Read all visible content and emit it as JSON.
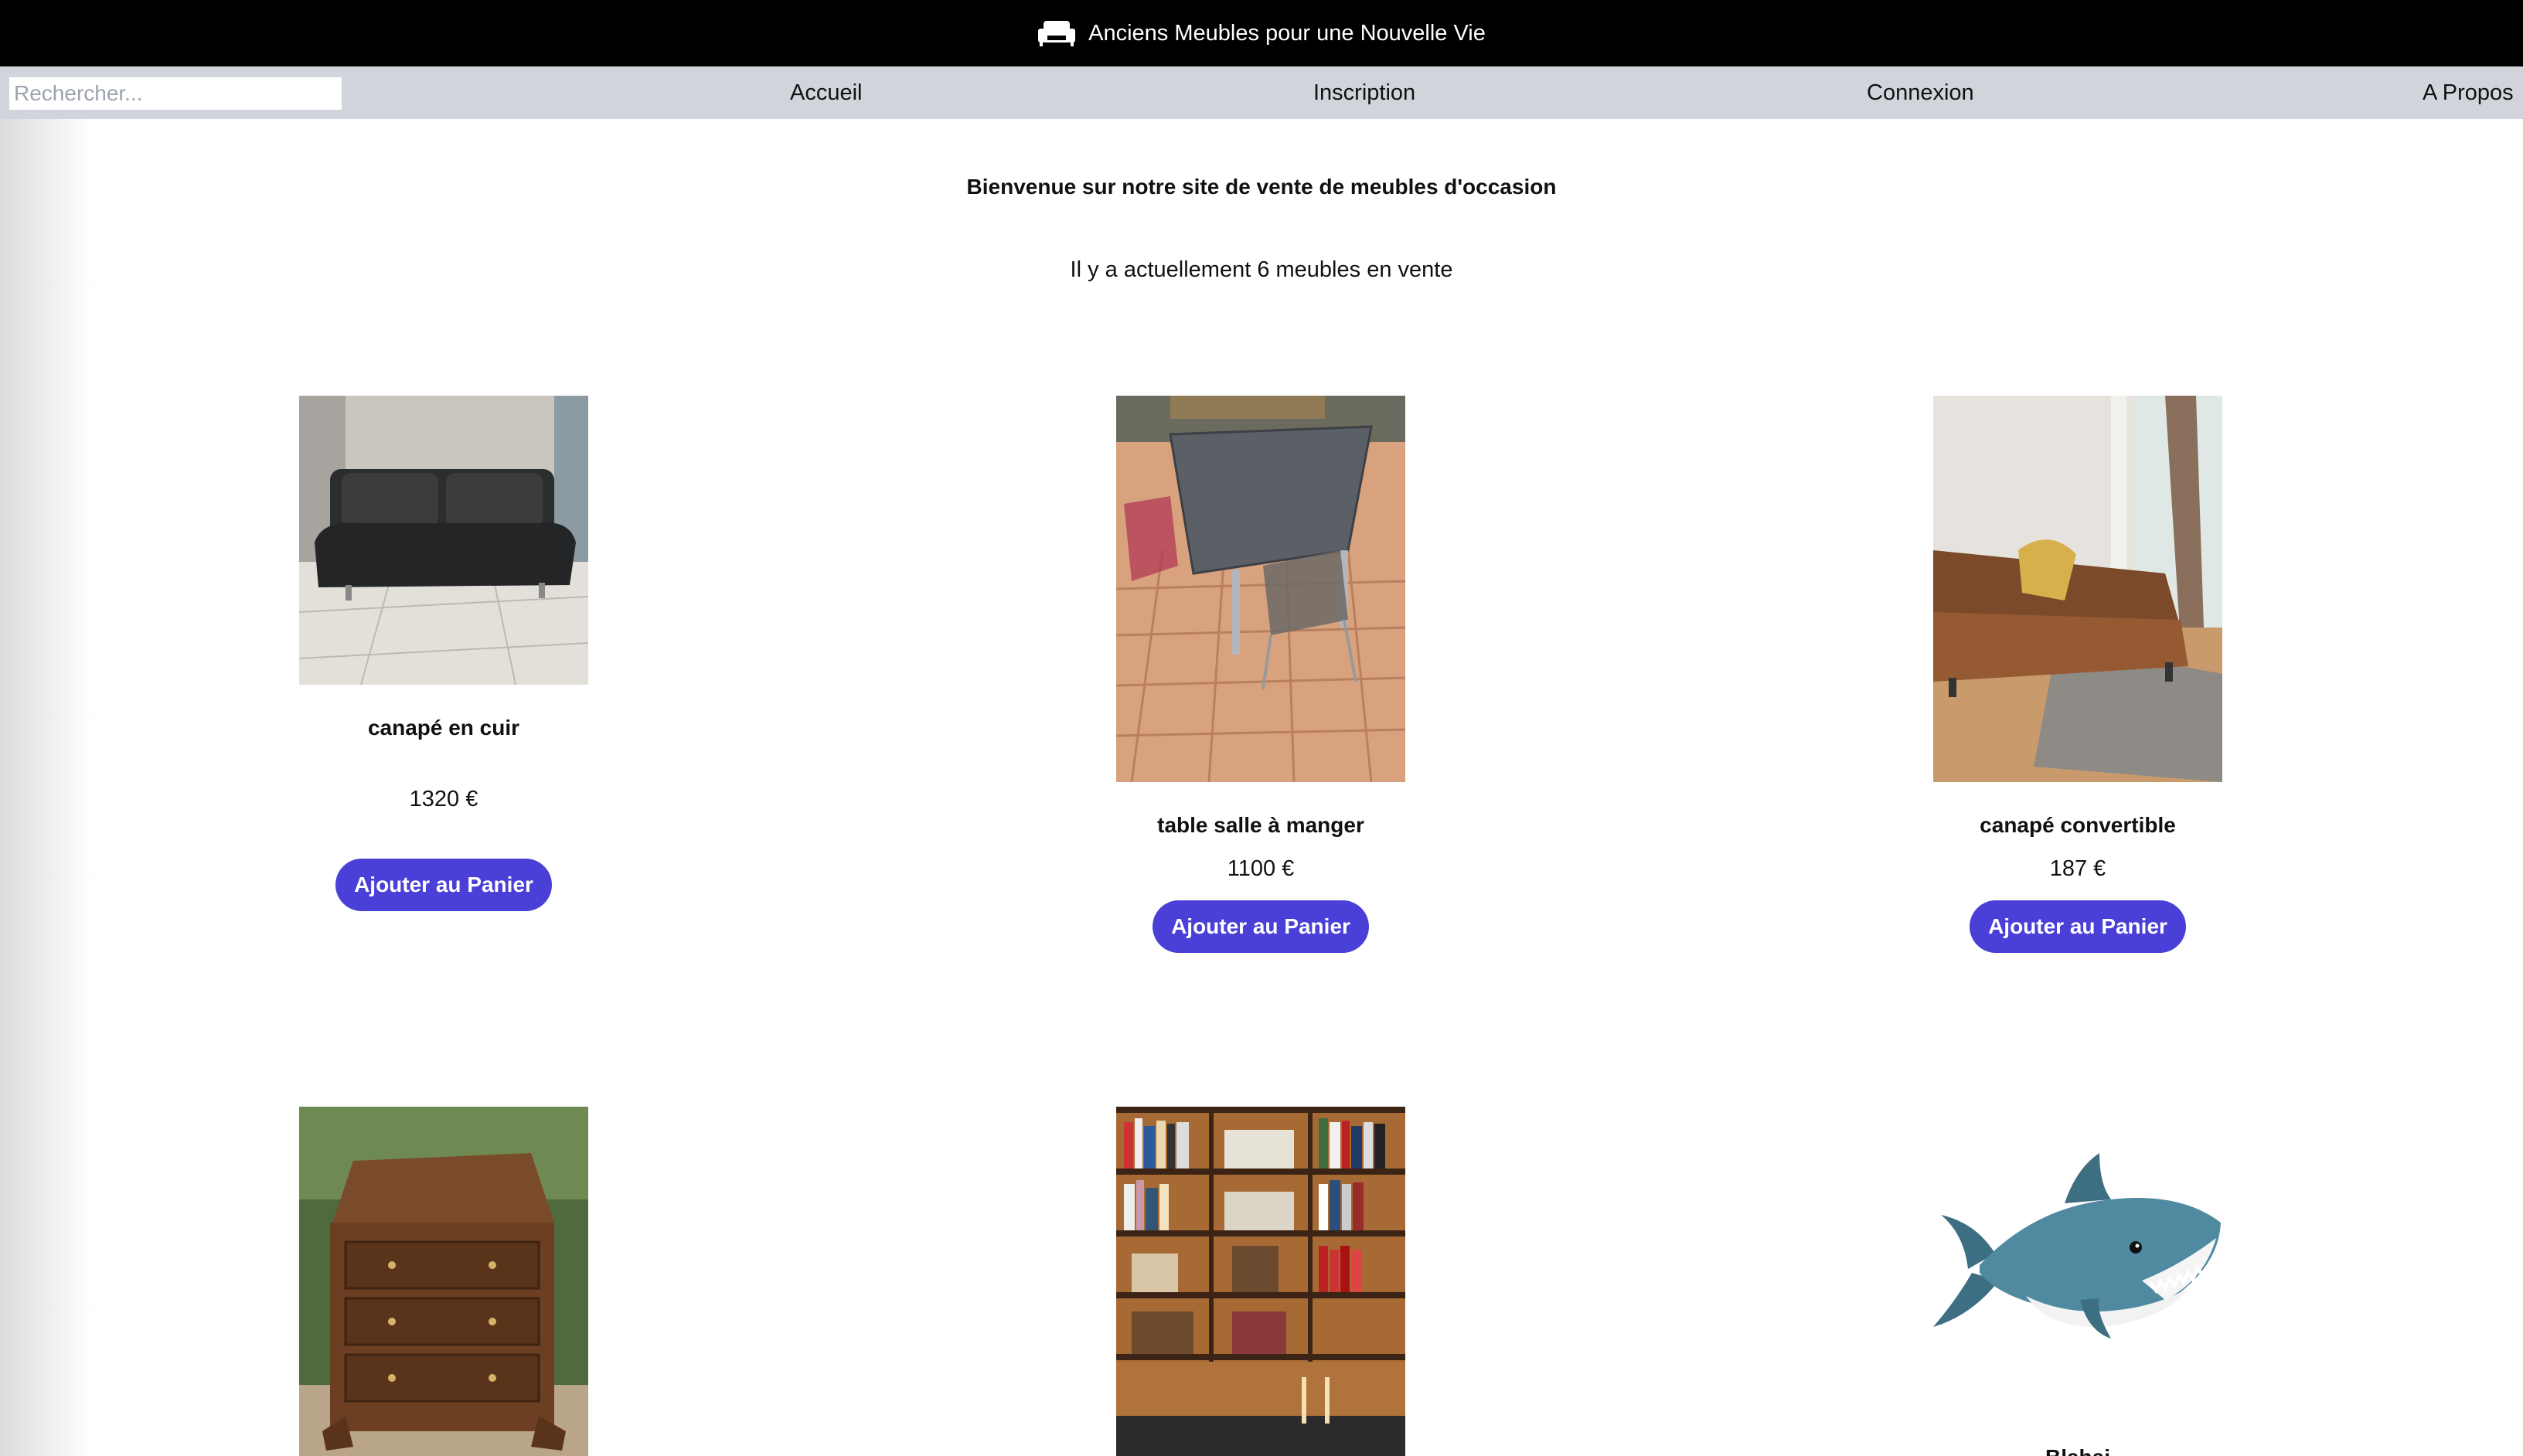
{
  "header": {
    "site_title": "Anciens Meubles pour une Nouvelle Vie",
    "logo_icon": "sofa-icon"
  },
  "nav": {
    "search_placeholder": "Rechercher...",
    "links": [
      {
        "label": "Accueil"
      },
      {
        "label": "Inscription"
      },
      {
        "label": "Connexion"
      },
      {
        "label": "A Propos"
      }
    ]
  },
  "main": {
    "welcome": "Bienvenue sur notre site de vente de meubles d'occasion",
    "count_text": "Il y a actuellement 6 meubles en vente",
    "products": [
      {
        "name": "canapé en cuir",
        "price": "1320 €",
        "button": "Ajouter au Panier",
        "image": "black-leather-sofa-photo"
      },
      {
        "name": "table salle à manger",
        "price": "1100 €",
        "button": "Ajouter au Panier",
        "image": "dining-table-photo"
      },
      {
        "name": "canapé convertible",
        "price": "187 €",
        "button": "Ajouter au Panier",
        "image": "brown-sofa-bed-photo"
      },
      {
        "name": "",
        "price": "",
        "button": "",
        "image": "wooden-secretary-desk-photo"
      },
      {
        "name": "",
        "price": "",
        "button": "",
        "image": "bookshelf-photo"
      },
      {
        "name": "Blahaj",
        "price": "",
        "button": "",
        "image": "shark-plush-photo"
      }
    ]
  },
  "colors": {
    "header_bg": "#000000",
    "nav_bg": "#d1d5db",
    "button_bg": "#4a3fd6",
    "button_text": "#ffffff"
  }
}
